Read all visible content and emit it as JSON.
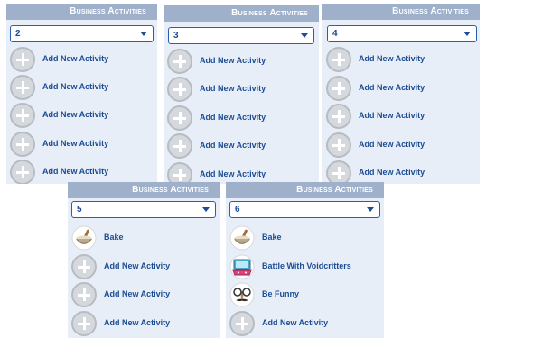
{
  "panels": [
    {
      "title": "Business Activities",
      "selected": "2",
      "items": [
        {
          "label": "Add New Activity",
          "icon": "add-icon"
        },
        {
          "label": "Add New Activity",
          "icon": "add-icon"
        },
        {
          "label": "Add New Activity",
          "icon": "add-icon"
        },
        {
          "label": "Add New Activity",
          "icon": "add-icon"
        },
        {
          "label": "Add New Activity",
          "icon": "add-icon"
        }
      ]
    },
    {
      "title": "Business Activities",
      "selected": "3",
      "items": [
        {
          "label": "Add New Activity",
          "icon": "add-icon"
        },
        {
          "label": "Add New Activity",
          "icon": "add-icon"
        },
        {
          "label": "Add New Activity",
          "icon": "add-icon"
        },
        {
          "label": "Add New Activity",
          "icon": "add-icon"
        },
        {
          "label": "Add New Activity",
          "icon": "add-icon"
        }
      ]
    },
    {
      "title": "Business Activities",
      "selected": "4",
      "items": [
        {
          "label": "Add New Activity",
          "icon": "add-icon"
        },
        {
          "label": "Add New Activity",
          "icon": "add-icon"
        },
        {
          "label": "Add New Activity",
          "icon": "add-icon"
        },
        {
          "label": "Add New Activity",
          "icon": "add-icon"
        },
        {
          "label": "Add New Activity",
          "icon": "add-icon"
        }
      ]
    },
    {
      "title": "Business Activities",
      "selected": "5",
      "items": [
        {
          "label": "Bake",
          "icon": "mixing-bowl-icon"
        },
        {
          "label": "Add New Activity",
          "icon": "add-icon"
        },
        {
          "label": "Add New Activity",
          "icon": "add-icon"
        },
        {
          "label": "Add New Activity",
          "icon": "add-icon"
        }
      ]
    },
    {
      "title": "Business Activities",
      "selected": "6",
      "items": [
        {
          "label": "Bake",
          "icon": "mixing-bowl-icon"
        },
        {
          "label": "Battle With Voidcritters",
          "icon": "game-console-icon"
        },
        {
          "label": "Be Funny",
          "icon": "funny-glasses-icon"
        },
        {
          "label": "Add New Activity",
          "icon": "add-icon"
        }
      ]
    }
  ]
}
